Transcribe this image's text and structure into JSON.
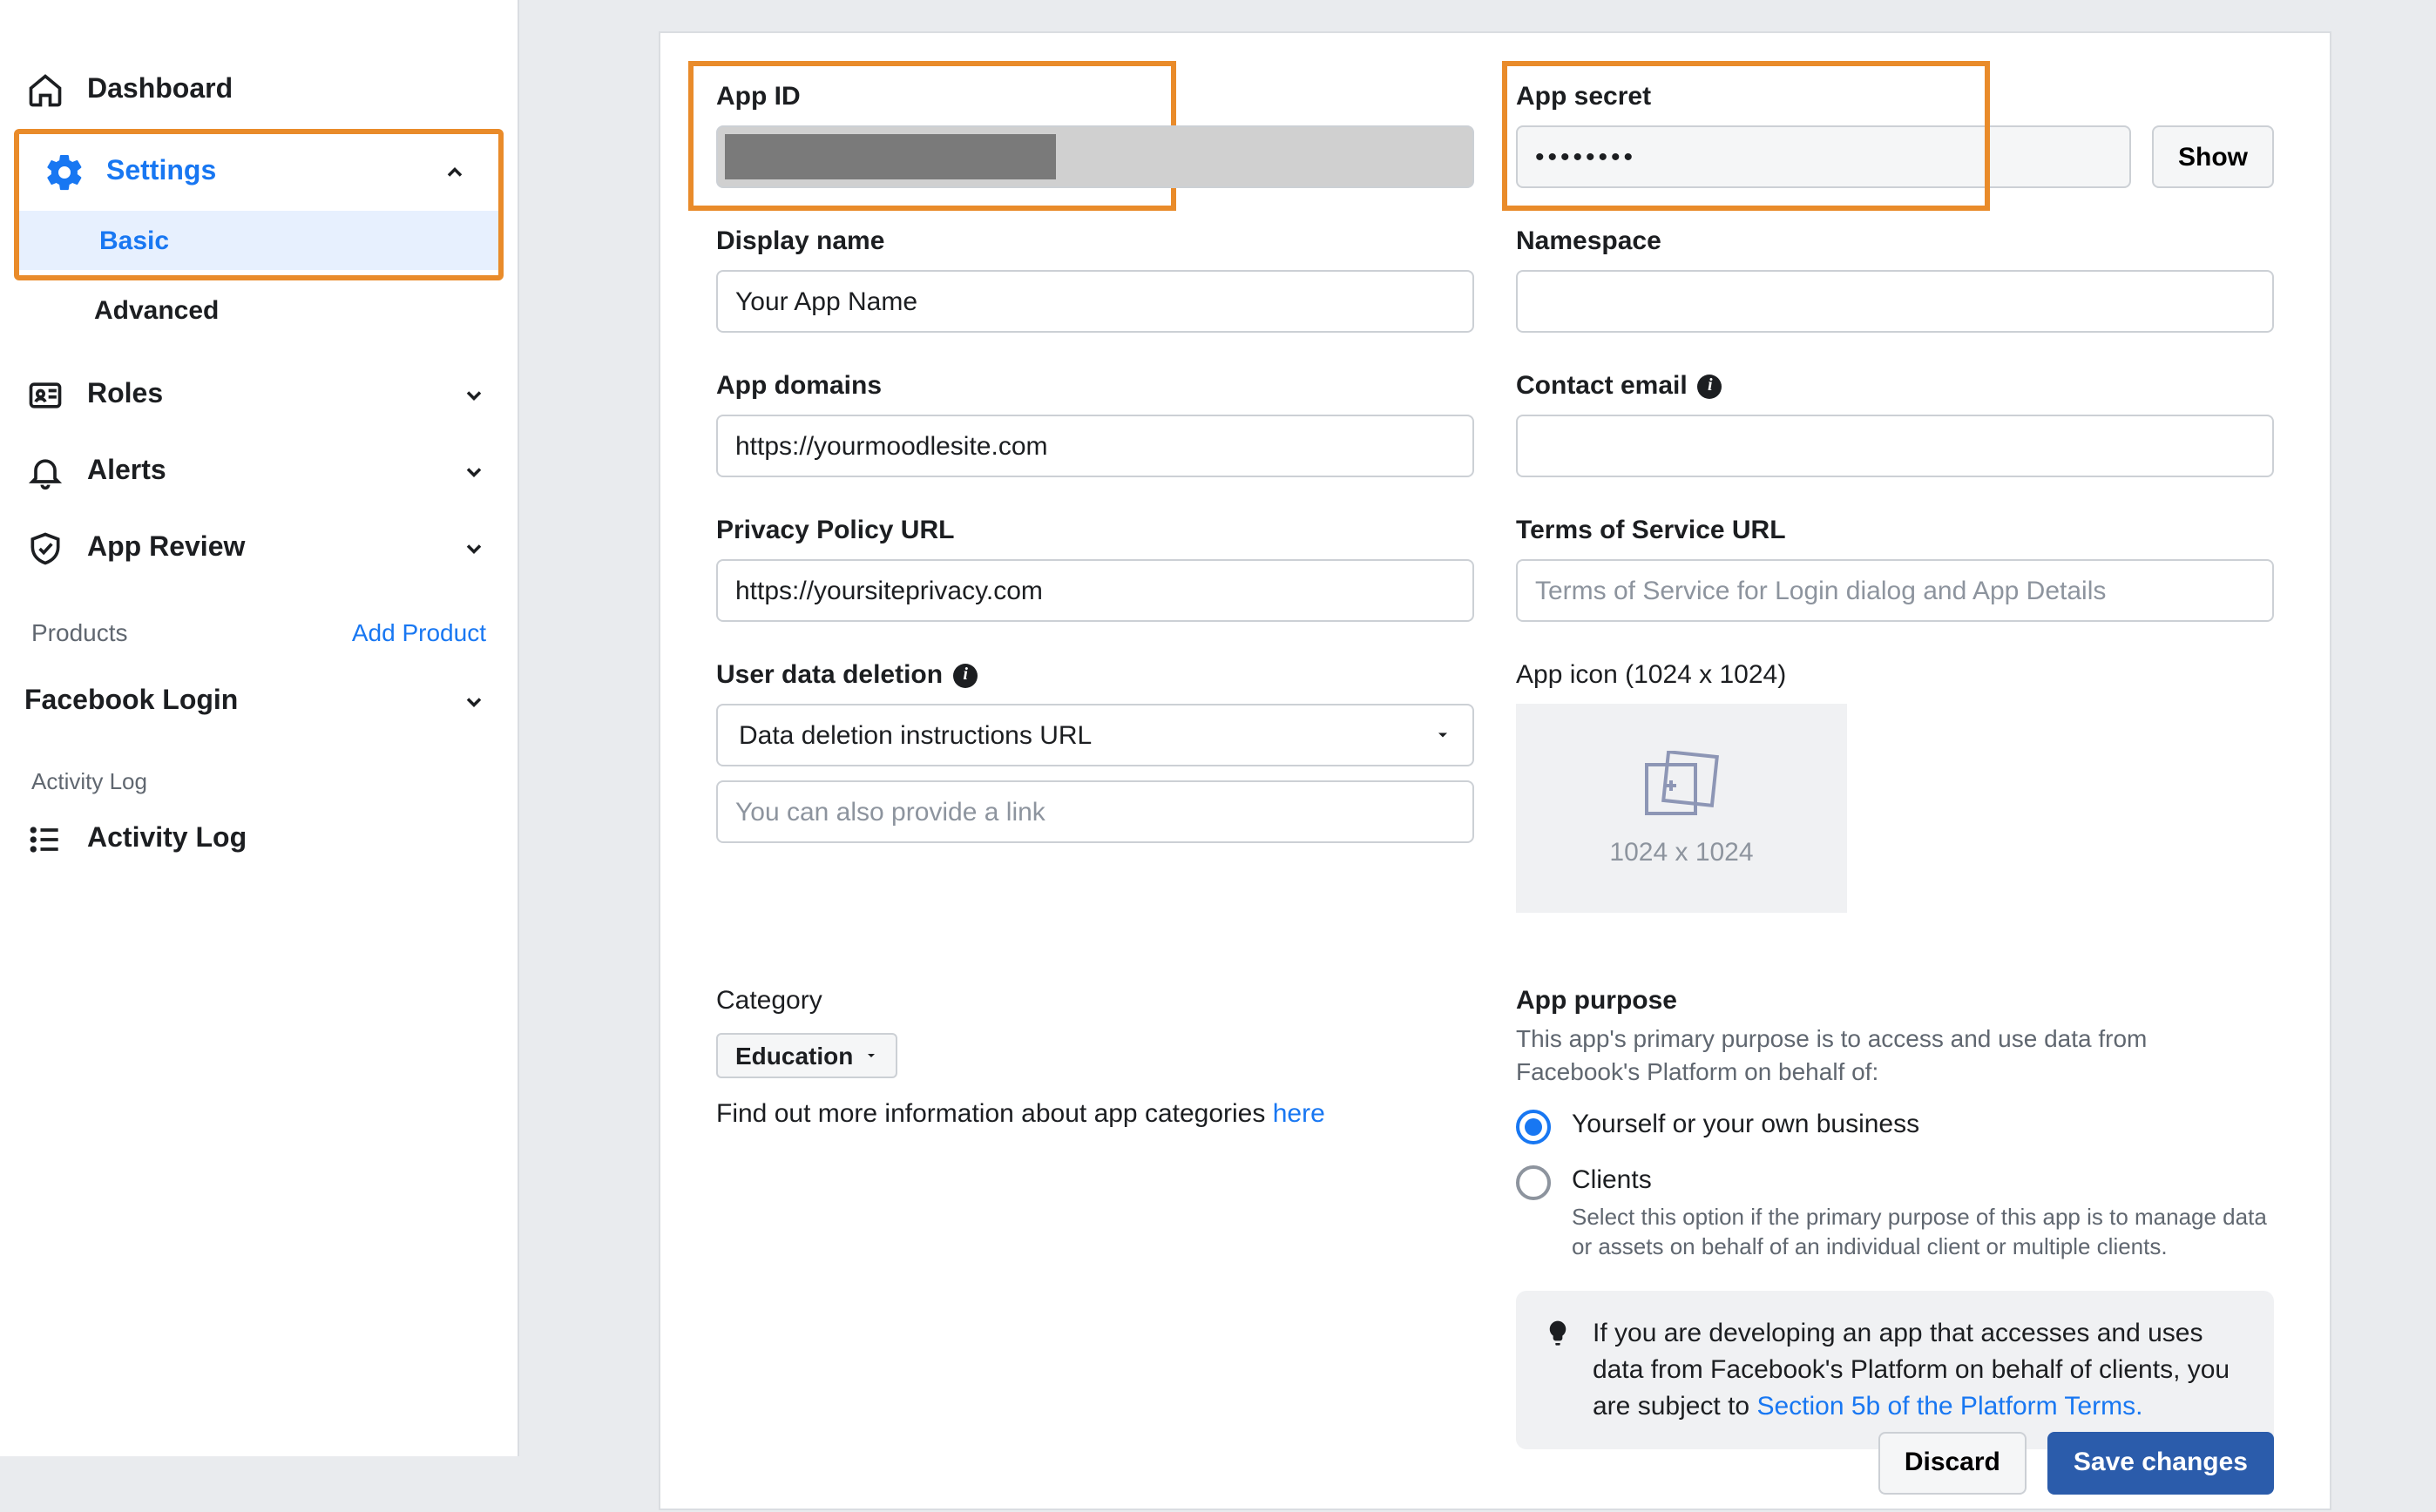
{
  "sidebar": {
    "dashboard": "Dashboard",
    "settings": "Settings",
    "settings_basic": "Basic",
    "settings_advanced": "Advanced",
    "roles": "Roles",
    "alerts": "Alerts",
    "app_review": "App Review",
    "products_header": "Products",
    "add_product": "Add Product",
    "facebook_login": "Facebook Login",
    "activity_log_header": "Activity Log",
    "activity_log": "Activity Log"
  },
  "form": {
    "app_id": {
      "label": "App ID",
      "value": ""
    },
    "app_secret": {
      "label": "App secret",
      "value": "••••••••",
      "show_btn": "Show"
    },
    "display_name": {
      "label": "Display name",
      "value": "Your App Name"
    },
    "namespace": {
      "label": "Namespace",
      "value": ""
    },
    "app_domains": {
      "label": "App domains",
      "value": "https://yourmoodlesite.com"
    },
    "contact_email": {
      "label": "Contact email",
      "value": ""
    },
    "privacy_url": {
      "label": "Privacy Policy URL",
      "value": "https://yoursiteprivacy.com"
    },
    "tos_url": {
      "label": "Terms of Service URL",
      "placeholder": "Terms of Service for Login dialog and App Details",
      "value": ""
    },
    "user_data_deletion": {
      "label": "User data deletion",
      "selected": "Data deletion instructions URL",
      "link_placeholder": "You can also provide a link"
    },
    "app_icon": {
      "label": "App icon (1024 x 1024)",
      "dim_text": "1024 x 1024"
    },
    "category": {
      "label": "Category",
      "selected": "Education",
      "hint_prefix": "Find out more information about app categories ",
      "hint_link": "here"
    },
    "app_purpose": {
      "label": "App purpose",
      "desc": "This app's primary purpose is to access and use data from Facebook's Platform on behalf of:",
      "opt_self": "Yourself or your own business",
      "opt_clients": "Clients",
      "opt_clients_hint": "Select this option if the primary purpose of this app is to manage data or assets on behalf of an individual client or multiple clients.",
      "tip_text": "If you are developing an app that accesses and uses data from Facebook's Platform on behalf of clients, you are subject to ",
      "tip_link": "Section 5b of the Platform Terms."
    }
  },
  "footer": {
    "discard": "Discard",
    "save": "Save changes"
  }
}
